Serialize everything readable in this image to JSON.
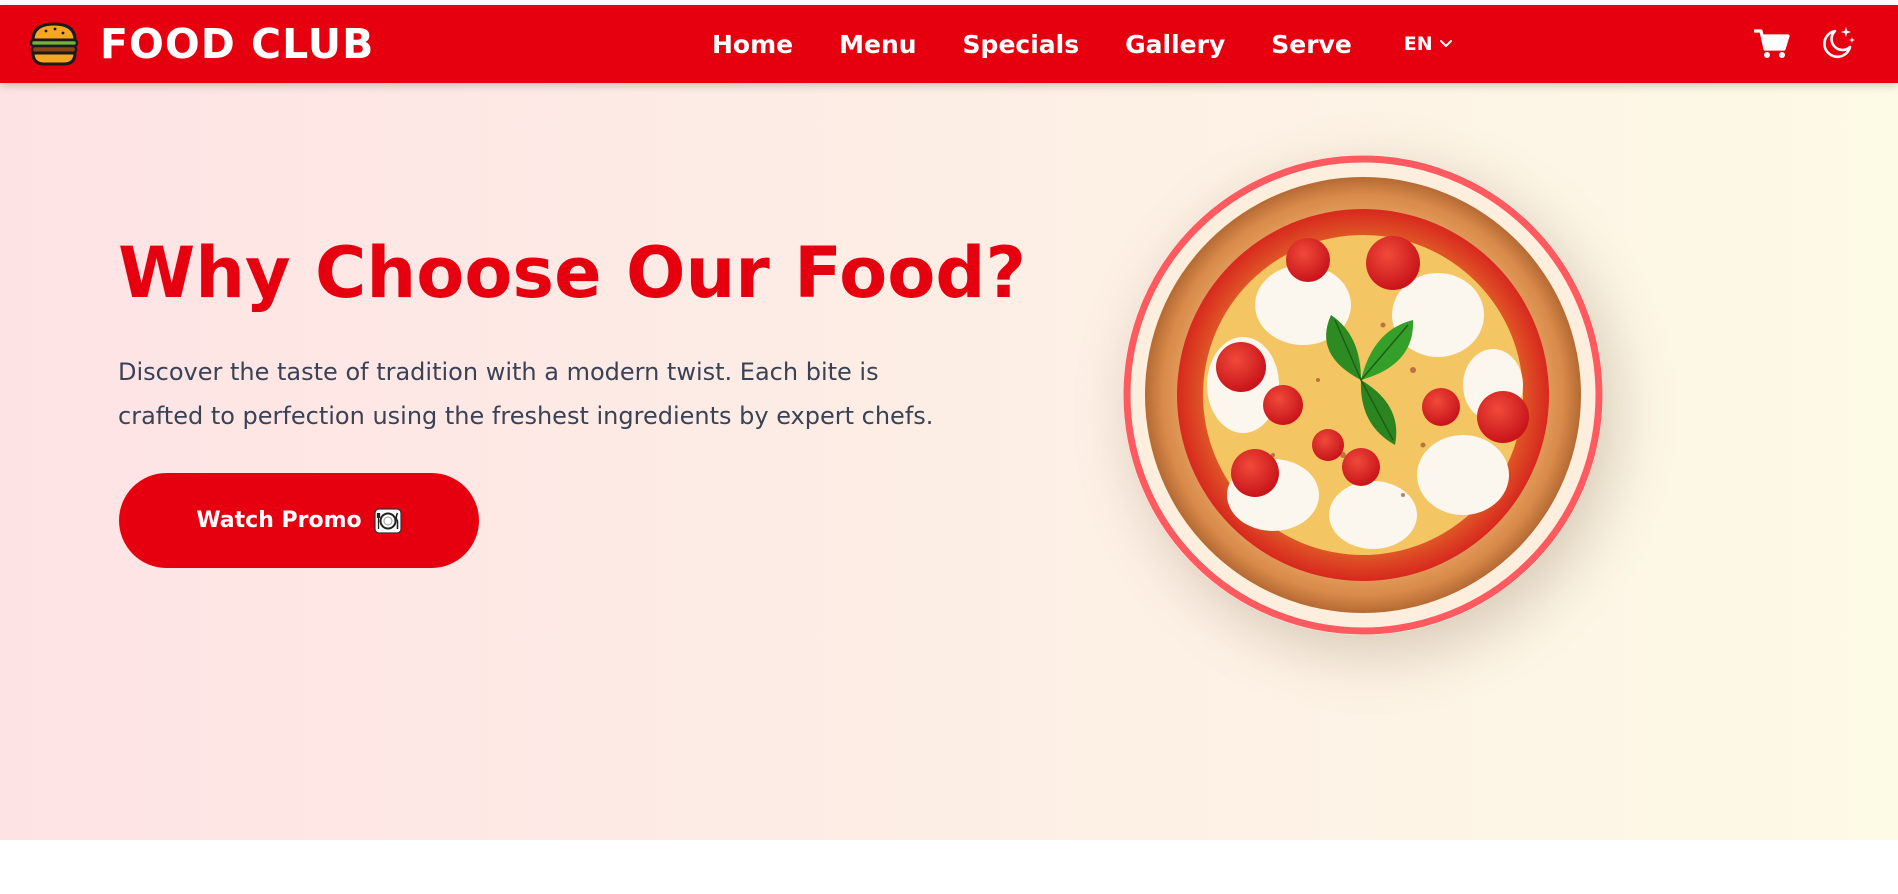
{
  "brand": {
    "name": "FOOD CLUB",
    "logo_icon": "burger-icon"
  },
  "nav": {
    "links": [
      "Home",
      "Menu",
      "Specials",
      "Gallery",
      "Serve"
    ],
    "language": "EN",
    "cart_icon": "cart-icon",
    "theme_icon": "moon-icon"
  },
  "hero": {
    "title": "Why Choose Our Food?",
    "description": "Discover the taste of tradition with a modern twist. Each bite is crafted to perfection using the freshest ingredients by expert chefs.",
    "button_label": "Watch Promo",
    "button_icon": "plate-icon",
    "image": "pizza-image"
  },
  "colors": {
    "brand_red": "#e6000f",
    "hero_gradient_start": "#fee3e5",
    "hero_gradient_end": "#fdfae6",
    "pizza_ring": "#ff5a60",
    "body_text": "#3a4256"
  }
}
